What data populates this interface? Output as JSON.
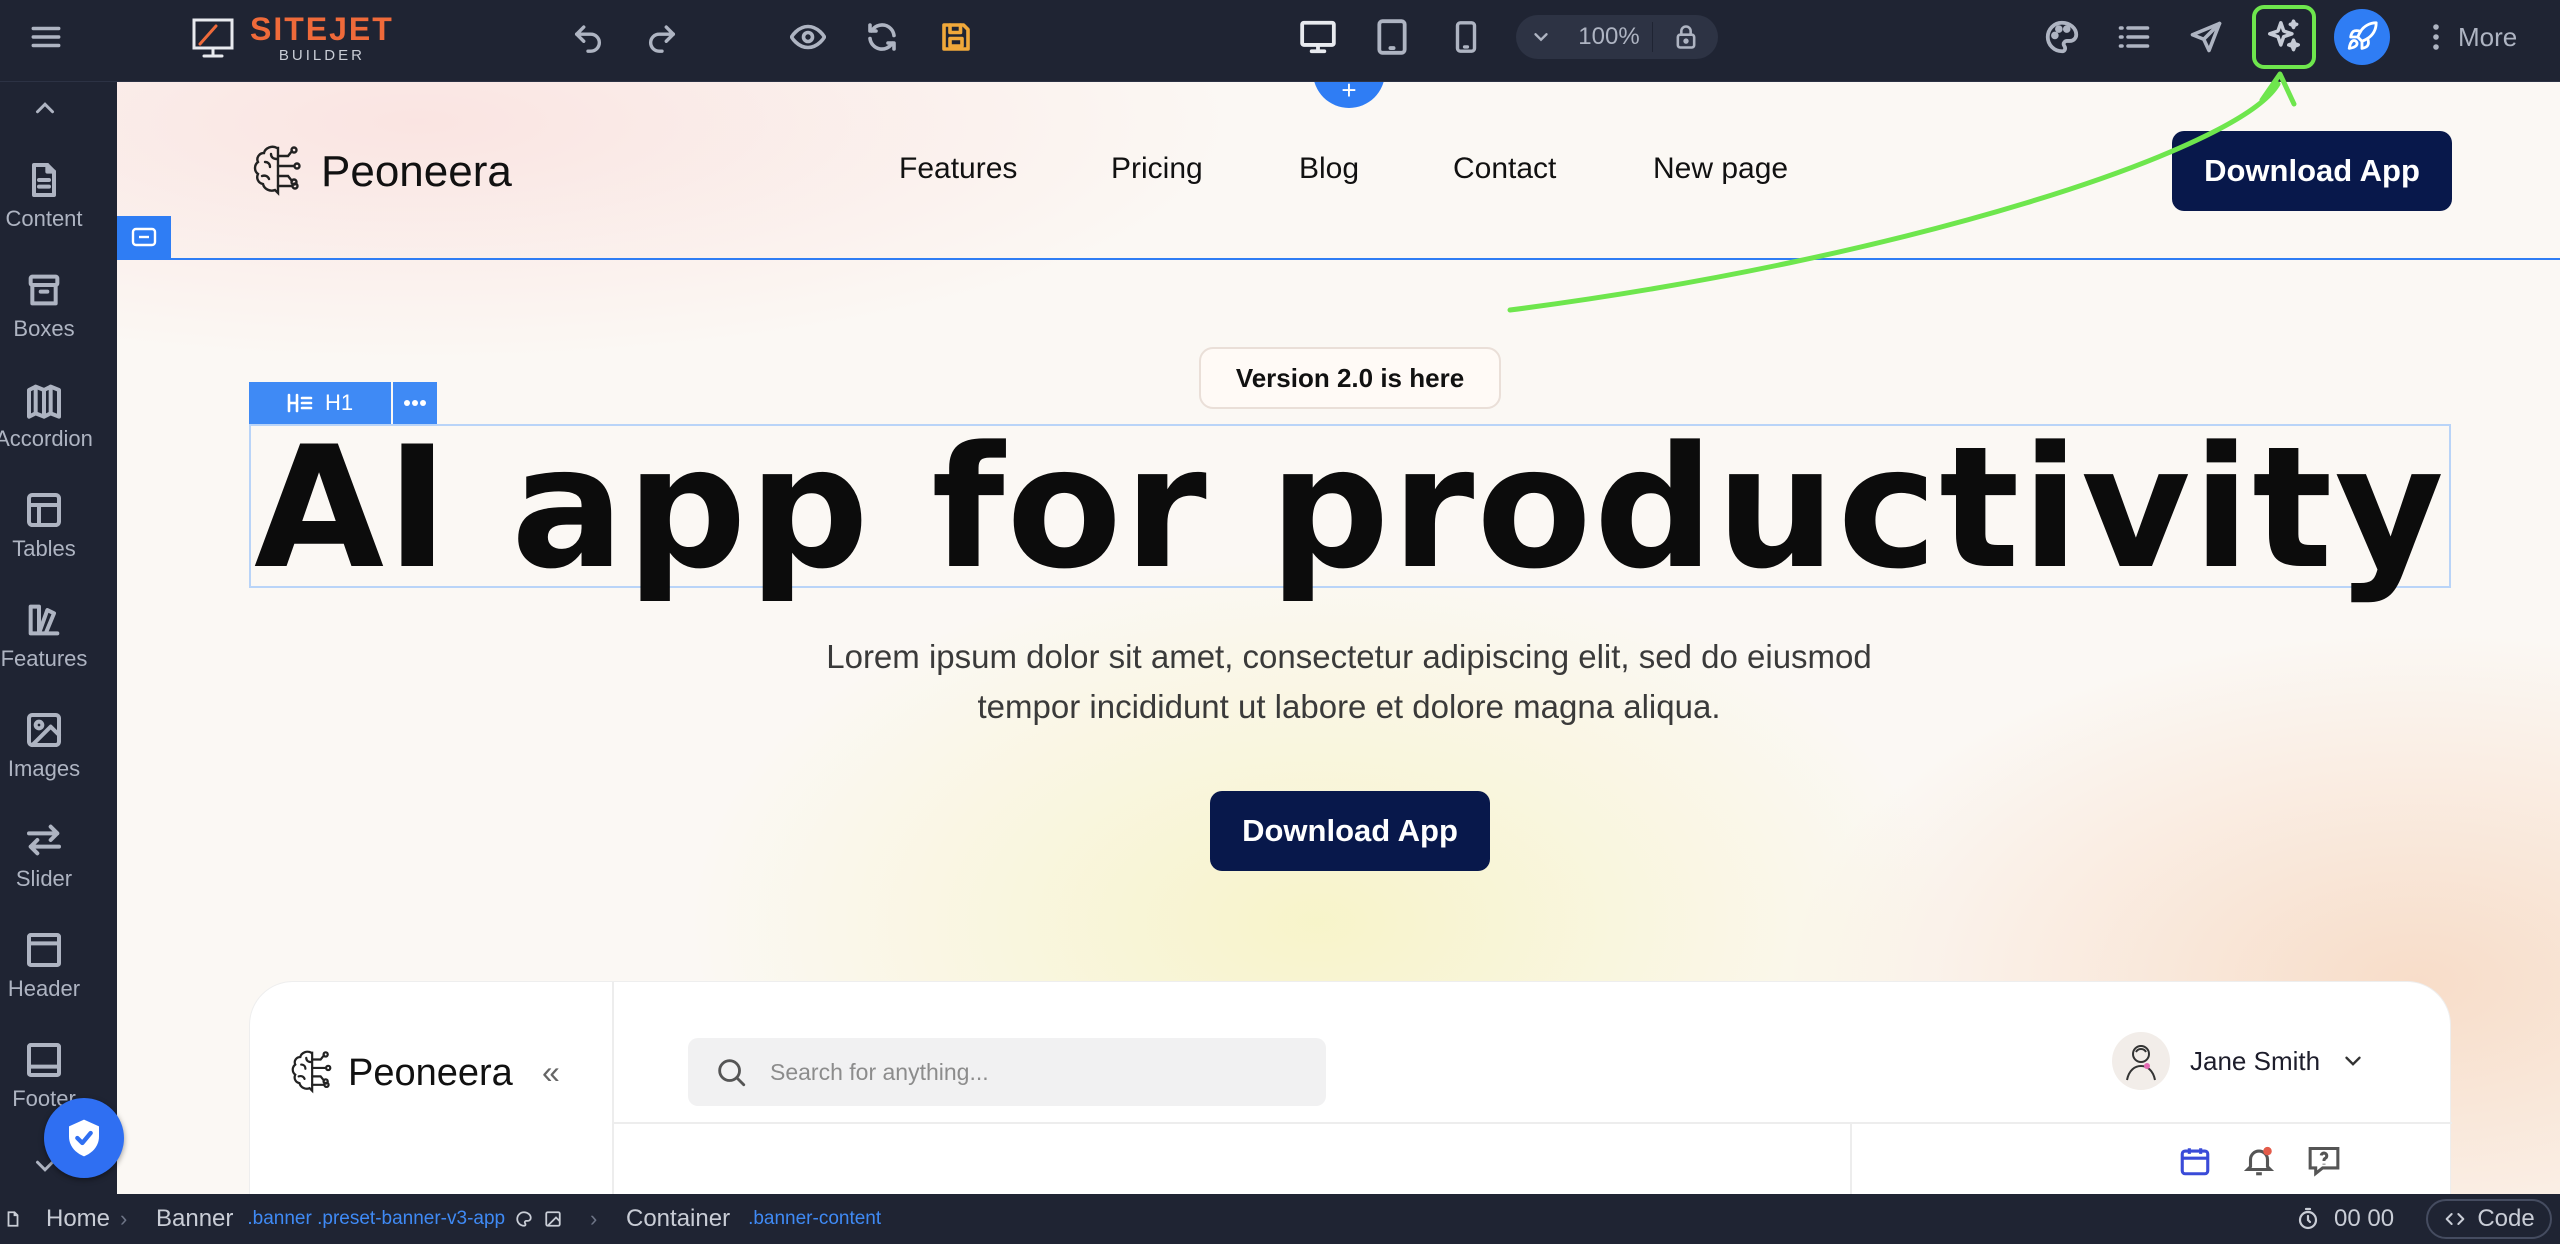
{
  "toolbar": {
    "logo_text": "SITEJET",
    "logo_sub": "BUILDER",
    "zoom": "100%",
    "more_label": "More",
    "colors": {
      "accent": "#2f7df4",
      "save": "#f0a83a",
      "highlight": "#6ee64d",
      "logo": "#ef6a3a"
    }
  },
  "sidebar": {
    "items": [
      {
        "label": "Content",
        "icon": "file-icon"
      },
      {
        "label": "Boxes",
        "icon": "archive-icon"
      },
      {
        "label": "Accordion",
        "icon": "accordion-icon"
      },
      {
        "label": "Tables",
        "icon": "table-icon"
      },
      {
        "label": "Features",
        "icon": "features-icon"
      },
      {
        "label": "Images",
        "icon": "image-icon"
      },
      {
        "label": "Slider",
        "icon": "slider-arrows-icon"
      },
      {
        "label": "Header",
        "icon": "header-icon"
      },
      {
        "label": "Footer",
        "icon": "footer-icon"
      }
    ]
  },
  "site": {
    "brand": "Peoneera",
    "nav": [
      "Features",
      "Pricing",
      "Blog",
      "Contact",
      "New page"
    ],
    "header_cta": "Download App",
    "badge": "Version 2.0 is here",
    "h1_tag": "H1",
    "hero_title": "AI app for productivity",
    "hero_sub_line1": "Lorem ipsum dolor sit amet, consectetur adipiscing elit, sed do eiusmod",
    "hero_sub_line2": "tempor incididunt ut labore et dolore magna aliqua.",
    "hero_cta": "Download App",
    "colors": {
      "cta": "#08184b"
    }
  },
  "mockup": {
    "brand": "Peoneera",
    "collapse": "«",
    "search_placeholder": "Search for anything...",
    "user_name": "Jane Smith"
  },
  "statusbar": {
    "crumbs": [
      {
        "label": "Home",
        "cls": ""
      },
      {
        "label": "Banner",
        "cls": ".banner .preset-banner-v3-app"
      },
      {
        "label": "Container",
        "cls": ".banner-content"
      }
    ],
    "timer": "00 00",
    "code_label": "Code"
  }
}
